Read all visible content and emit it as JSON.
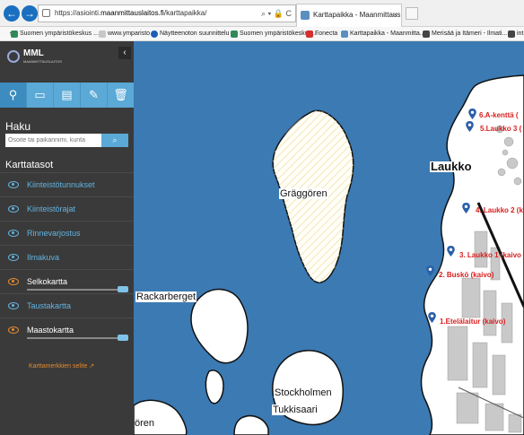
{
  "browser": {
    "url_prefix": "https://asiointi.",
    "url_host": "maanmittauslaitos.fi",
    "url_path": "/karttapaikka/",
    "tab_title": "Karttapaikka - Maanmittaus...",
    "bookmarks": [
      "Suomen ympäristökeskus ...",
      "www.ymparisto",
      "Näytteenoton suunnittelu",
      "Suomen ympäristökeskus ...",
      "Fonecta",
      "Karttapaikka - Maanmitta...",
      "Merisää ja Itämeri - Ilmati...",
      "int"
    ]
  },
  "sidebar": {
    "logo": {
      "text": "MML",
      "subtitle": "MAANMITTAUSLAITOS"
    },
    "collapse_glyph": "‹",
    "tools": [
      {
        "icon": "location-pin-icon",
        "glyph": "⚲"
      },
      {
        "icon": "measure-ruler-icon",
        "glyph": "▭"
      },
      {
        "icon": "map-window-icon",
        "glyph": "▤"
      },
      {
        "icon": "add-marker-icon",
        "glyph": "✎"
      },
      {
        "icon": "trash-icon",
        "glyph": "🗑"
      }
    ],
    "haku": {
      "title": "Haku",
      "placeholder": "Osoite tai paikannimi, kunta",
      "button_glyph": "⌕"
    },
    "karttatasot": {
      "title": "Karttatasot",
      "layers": [
        {
          "label": "Kiinteistötunnukset",
          "visible": false
        },
        {
          "label": "Kiinteistörajat",
          "visible": false
        },
        {
          "label": "Rinnevarjostus",
          "visible": false
        },
        {
          "label": "Ilmakuva",
          "visible": false
        },
        {
          "label": "Selkokartta",
          "visible": true
        },
        {
          "label": "Taustakartta",
          "visible": false
        },
        {
          "label": "Maastokartta",
          "visible": true
        }
      ]
    },
    "legend_link": "Karttamerkkien selite ↗"
  },
  "map": {
    "labels": {
      "graggoren": "Gräggören",
      "rackarberget": "Rackarberget",
      "laukko": "Laukko",
      "stockholmen": "Stockholmen",
      "tukkisaari": "Tukkisaari",
      "oren": "ören"
    },
    "pois": [
      "6.A-kenttä (",
      "5.Laukko 3 (",
      "4. Laukko 2 (k",
      "3. Laukko 1 (kaivo",
      "2. Buskö (kaivo)",
      "1.Etelälaitur (kaivo)"
    ],
    "colors": {
      "water": "#3c7ab3",
      "land": "#ffffff",
      "poi": "#d91e1e",
      "pin": "#2b5fa8"
    }
  }
}
